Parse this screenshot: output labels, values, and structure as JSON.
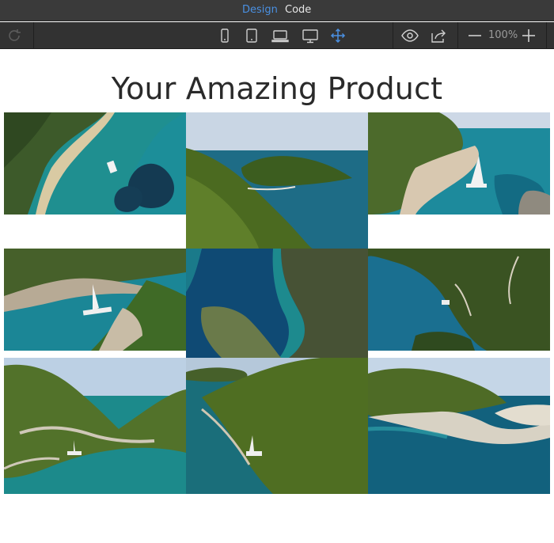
{
  "app": {
    "mode_tabs": [
      {
        "label": "Design",
        "active": true
      },
      {
        "label": "Code",
        "active": false
      }
    ],
    "accent_color": "#4a90e2"
  },
  "toolbar": {
    "refresh_icon": "refresh-icon",
    "device_icons": [
      "phone-icon",
      "tablet-icon",
      "laptop-icon",
      "desktop-icon",
      "move-icon"
    ],
    "active_device": "move-icon",
    "preview_icon": "eye-icon",
    "share_icon": "share-icon",
    "zoom_out_icon": "minus-icon",
    "zoom_level": "100%",
    "zoom_in_icon": "plus-icon"
  },
  "page": {
    "title": "Your Amazing Product",
    "gallery": [
      {
        "subject": "aerial beach cove with anchored boat"
      },
      {
        "subject": "forested bay with turquoise water"
      },
      {
        "subject": "rocky coast with sailing catamaran"
      },
      {
        "subject": "cove with sailboat and cliffs"
      },
      {
        "subject": "aerial narrow inlet with forest"
      },
      {
        "subject": "aerial forested coastline"
      },
      {
        "subject": "green hills bay with yacht"
      },
      {
        "subject": "forested peninsula with sailboat"
      },
      {
        "subject": "bay with white rocky shoreline"
      }
    ]
  }
}
